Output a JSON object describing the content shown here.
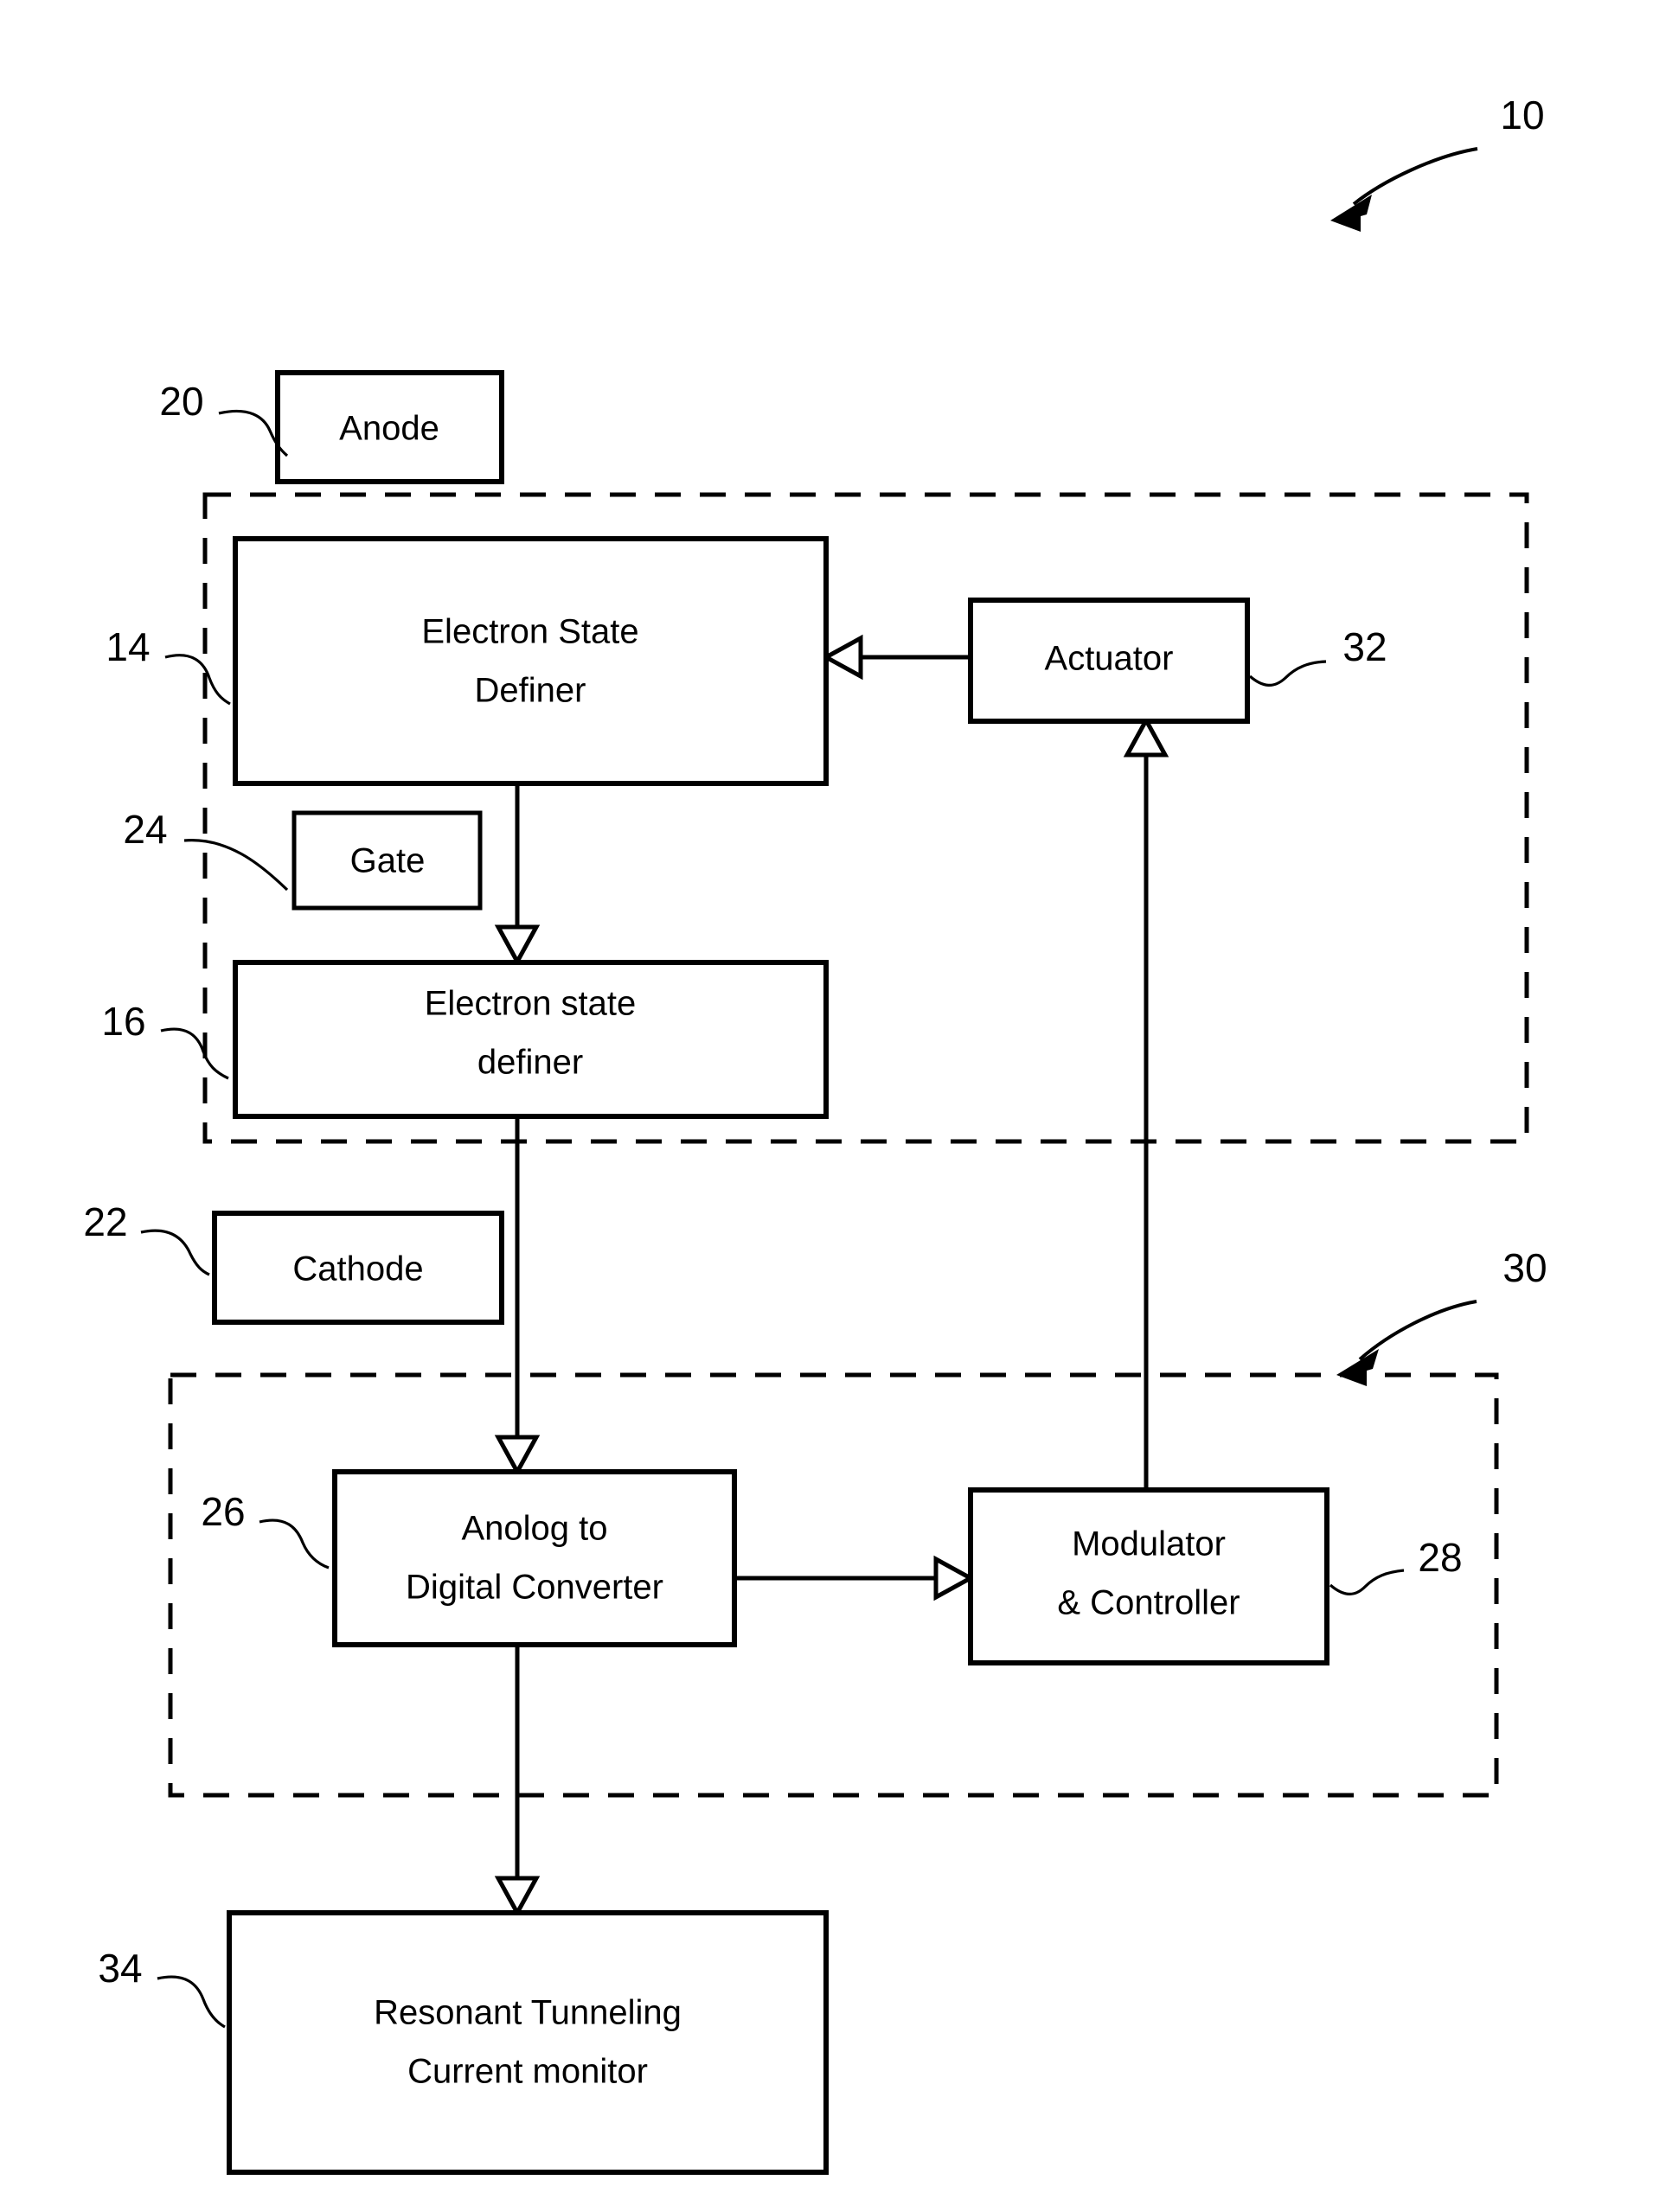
{
  "figure": {
    "overall_ref": "10",
    "blocks": [
      {
        "id": "anode",
        "ref": "20",
        "lines": [
          "Anode"
        ]
      },
      {
        "id": "esd14",
        "ref": "14",
        "lines": [
          "Electron State",
          "Definer"
        ]
      },
      {
        "id": "gate",
        "ref": "24",
        "lines": [
          "Gate"
        ]
      },
      {
        "id": "esd16",
        "ref": "16",
        "lines": [
          "Electron state",
          "definer"
        ]
      },
      {
        "id": "cathode",
        "ref": "22",
        "lines": [
          "Cathode"
        ]
      },
      {
        "id": "actuator",
        "ref": "32",
        "lines": [
          "Actuator"
        ]
      },
      {
        "id": "adc",
        "ref": "26",
        "lines": [
          "Anolog to",
          "Digital Converter"
        ]
      },
      {
        "id": "modulator",
        "ref": "28",
        "lines": [
          "Modulator",
          "& Controller"
        ]
      },
      {
        "id": "monitor",
        "ref": "34",
        "lines": [
          "Resonant Tunneling",
          "Current monitor"
        ]
      }
    ],
    "dashed_groups": [
      {
        "id": "upper-group",
        "ref": ""
      },
      {
        "id": "lower-group",
        "ref": "30"
      }
    ],
    "colors": {
      "ink": "#000000",
      "paper": "#ffffff"
    }
  }
}
